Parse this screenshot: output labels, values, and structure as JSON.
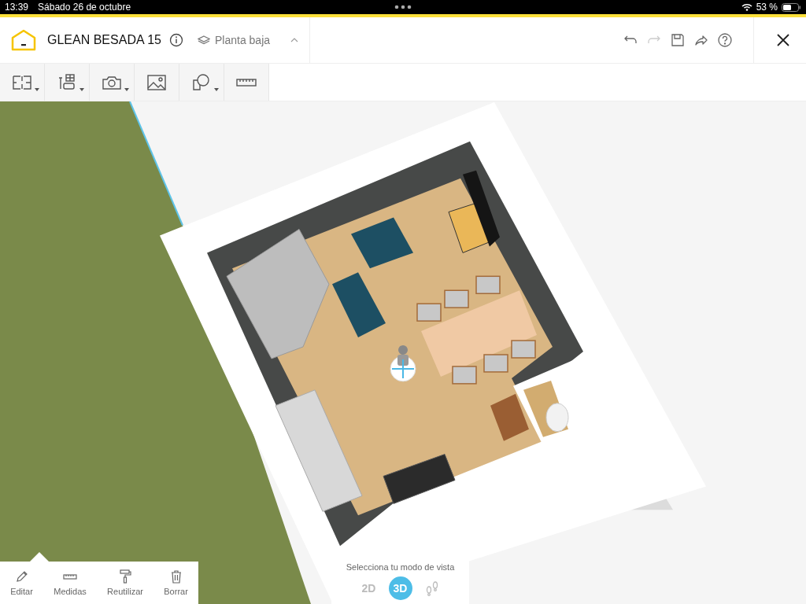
{
  "status_bar": {
    "time": "13:39",
    "date": "Sábado 26 de octubre",
    "battery": "53 %"
  },
  "header": {
    "title": "GLEAN BESADA 15",
    "floor": "Planta baja",
    "actions": [
      {
        "kind": "undo",
        "disabled": false
      },
      {
        "kind": "redo",
        "disabled": true
      },
      {
        "kind": "save",
        "disabled": false
      },
      {
        "kind": "share",
        "disabled": false
      },
      {
        "kind": "help",
        "disabled": false
      }
    ]
  },
  "toolbar": [
    {
      "kind": "floorplan",
      "dropdown": true
    },
    {
      "kind": "furniture",
      "dropdown": true
    },
    {
      "kind": "camera",
      "dropdown": true
    },
    {
      "kind": "image",
      "dropdown": false
    },
    {
      "kind": "shapes",
      "dropdown": true
    },
    {
      "kind": "ruler",
      "dropdown": false
    }
  ],
  "context_menu": [
    {
      "kind": "edit",
      "label": "Editar"
    },
    {
      "kind": "measure",
      "label": "Medidas"
    },
    {
      "kind": "reuse",
      "label": "Reutilizar"
    },
    {
      "kind": "delete",
      "label": "Borrar"
    }
  ],
  "view_mode": {
    "prompt": "Selecciona tu modo de vista",
    "modes": [
      {
        "kind": "text",
        "label": "2D",
        "selected": false
      },
      {
        "kind": "text",
        "label": "3D",
        "selected": true
      },
      {
        "kind": "walk",
        "selected": false
      }
    ]
  }
}
